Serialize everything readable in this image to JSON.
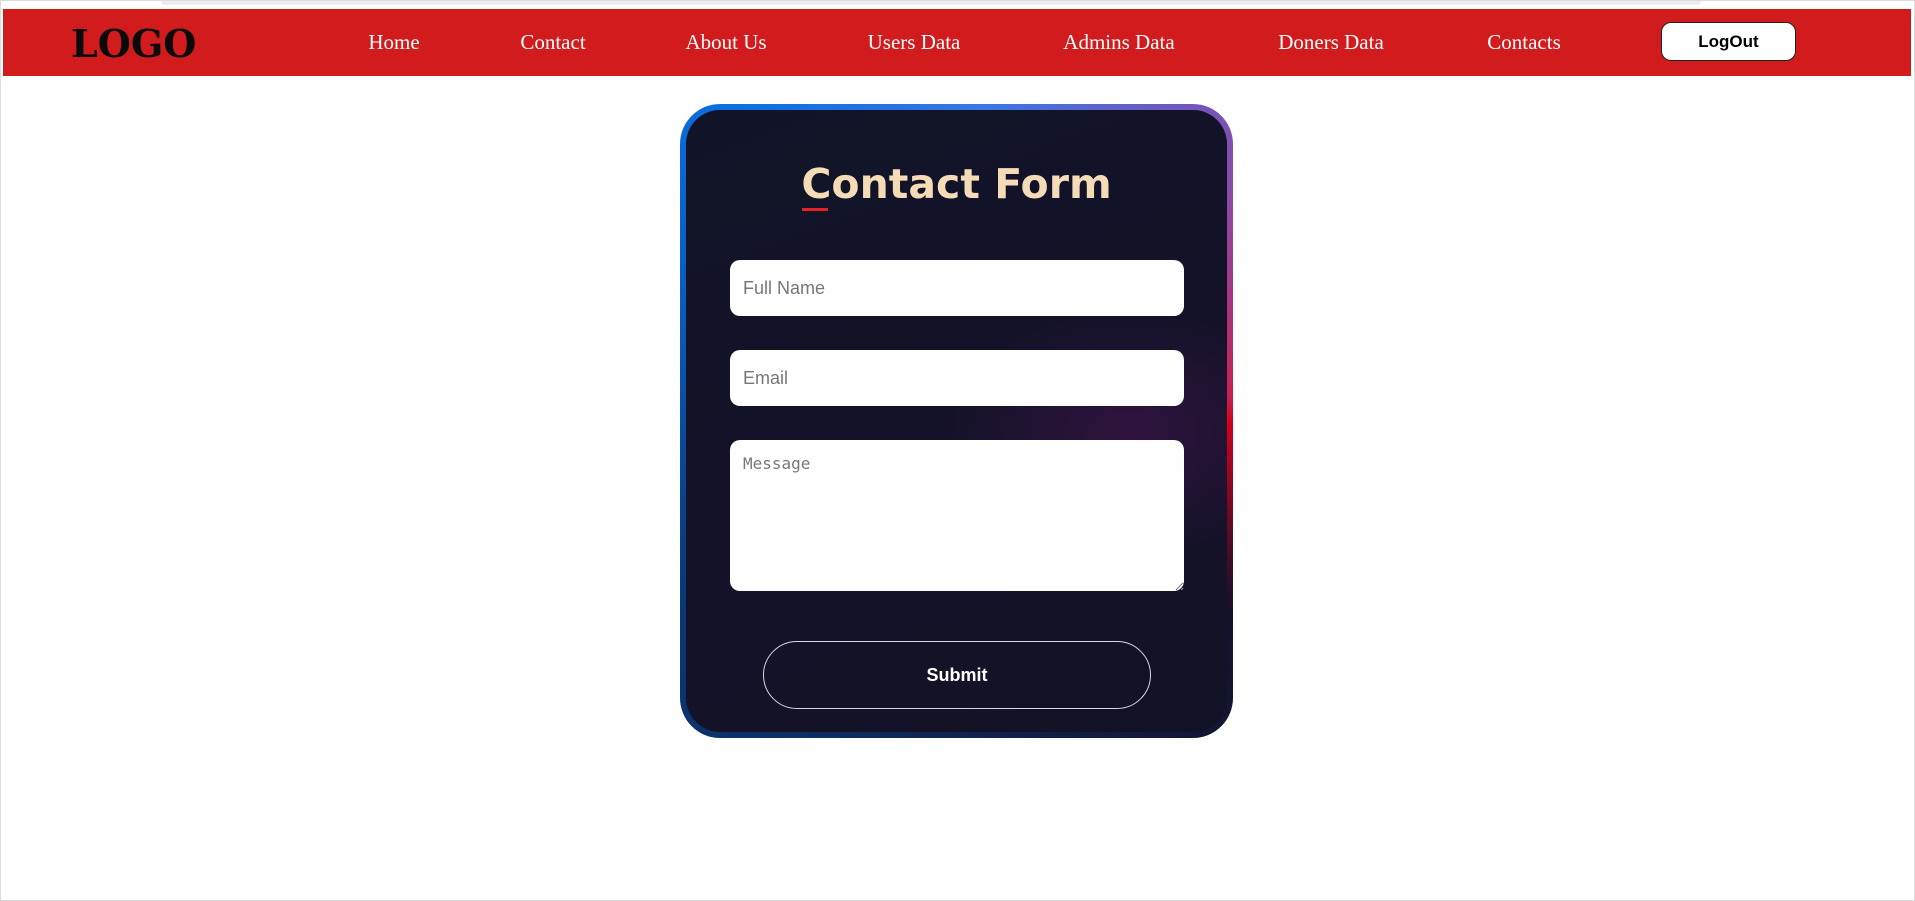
{
  "navbar": {
    "logo": "LOGO",
    "links": [
      {
        "label": "Home"
      },
      {
        "label": "Contact"
      },
      {
        "label": "About Us"
      },
      {
        "label": "Users Data"
      },
      {
        "label": "Admins Data"
      },
      {
        "label": "Doners Data"
      },
      {
        "label": "Contacts"
      }
    ],
    "logout_label": "LogOut"
  },
  "contact_form": {
    "title": "Contact Form",
    "full_name": {
      "value": "",
      "placeholder": "Full Name"
    },
    "email": {
      "value": "",
      "placeholder": "Email"
    },
    "message": {
      "value": "",
      "placeholder": "Message"
    },
    "submit_label": "Submit"
  },
  "colors": {
    "navbar_bg": "#d21b1d",
    "card_bg": "#121226",
    "title_color": "#f6dbb7",
    "page_bg": "#ffffff"
  }
}
